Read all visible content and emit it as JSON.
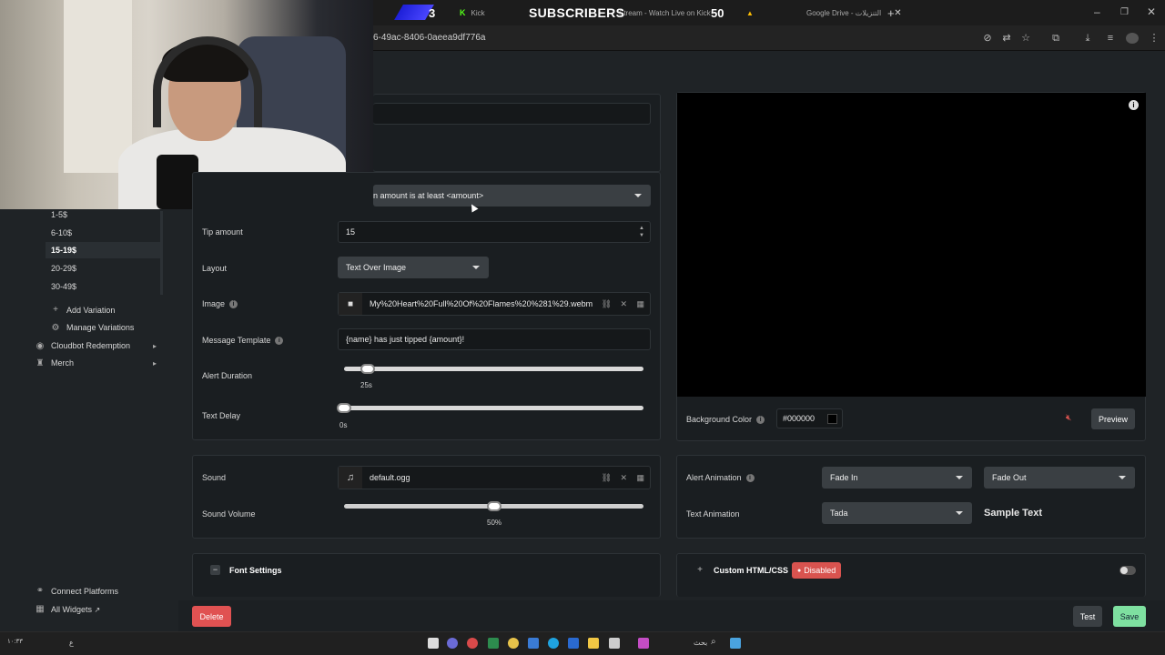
{
  "browser": {
    "tabs": [
      {
        "label": "Kick",
        "icon": "kick-icon"
      },
      {
        "label": "Stream - Watch Live on Kick"
      },
      {
        "label": "Google Drive - التنزيلات"
      }
    ],
    "url": "6-49ac-8406-0aeea9df776a",
    "new_tab": "+"
  },
  "overlay": {
    "left_count": "3",
    "label": "SUBSCRIBERS",
    "goal": "50"
  },
  "sidebar": {
    "variations": [
      "1-5$",
      "6-10$",
      "15-19$",
      "20-29$",
      "30-49$"
    ],
    "selected_variation": "15-19$",
    "add_variation": "Add Variation",
    "manage_variations": "Manage Variations",
    "cloudbot": "Cloudbot Redemption",
    "merch": "Merch",
    "connect_platforms": "Connect Platforms",
    "all_widgets": "All Widgets"
  },
  "form": {
    "condition_select": "n amount is at least <amount>",
    "tip_amount_label": "Tip amount",
    "tip_amount_value": "15",
    "layout_label": "Layout",
    "layout_value": "Text Over Image",
    "image_label": "Image",
    "image_file": "My%20Heart%20Full%20Of%20Flames%20%281%29.webm",
    "message_template_label": "Message Template",
    "message_template_value": "{name} has just tipped {amount}!",
    "alert_duration_label": "Alert Duration",
    "alert_duration_value": "25s",
    "alert_duration_fraction": 0.08,
    "text_delay_label": "Text Delay",
    "text_delay_value": "0s",
    "text_delay_fraction": 0.0
  },
  "sound": {
    "sound_label": "Sound",
    "sound_file": "default.ogg",
    "volume_label": "Sound Volume",
    "volume_value": "50%",
    "volume_fraction": 0.5
  },
  "font_settings": {
    "label": "Font Settings",
    "toggle": "−"
  },
  "preview": {
    "bg_label": "Background Color",
    "bg_value": "#000000",
    "bg_color": "#000000",
    "preview_button": "Preview"
  },
  "animation": {
    "alert_label": "Alert Animation",
    "in_value": "Fade In",
    "out_value": "Fade Out",
    "text_label": "Text Animation",
    "text_value": "Tada",
    "sample": "Sample Text"
  },
  "custom_html": {
    "toggle": "+",
    "label": "Custom HTML/CSS",
    "badge": "Disabled"
  },
  "actions": {
    "delete": "Delete",
    "test": "Test",
    "save": "Save"
  },
  "colors": {
    "delete": "#e05252",
    "save": "#7ee0a0",
    "badge": "#d9534f"
  },
  "taskbar": {
    "left_text": "١٠:٣٣",
    "search": "بحث",
    "lang": "ع"
  }
}
